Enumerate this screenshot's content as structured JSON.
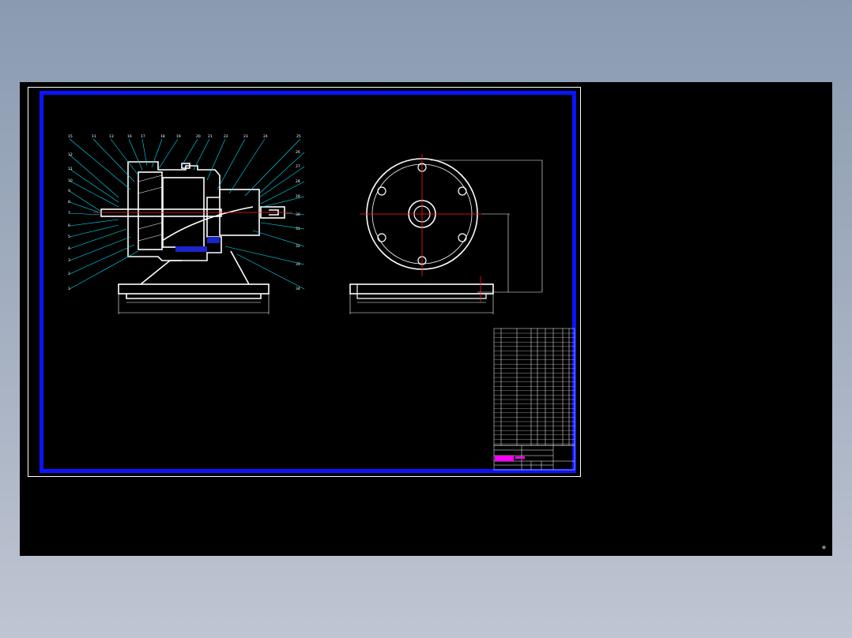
{
  "colors": {
    "background": "#000000",
    "frame": "#0a14ff",
    "outline": "#ffffff",
    "leader": "#00e5ff",
    "centerline": "#ff1a1a",
    "hatch": "#1c25c9",
    "title_highlight": "#ff00ff"
  },
  "drawing": {
    "leader_numbers_top": [
      "15",
      "11",
      "13",
      "16",
      "17",
      "18",
      "19",
      "20",
      "21",
      "22",
      "23",
      "24",
      "25"
    ],
    "leader_numbers_left": [
      "12",
      "11",
      "10",
      "9",
      "8",
      "7",
      "6",
      "5",
      "4",
      "3",
      "2",
      "1"
    ],
    "leader_numbers_right": [
      "26",
      "27",
      "28",
      "29",
      "30",
      "31",
      "32",
      "33",
      "34"
    ]
  },
  "corner_glyph": "⊕"
}
